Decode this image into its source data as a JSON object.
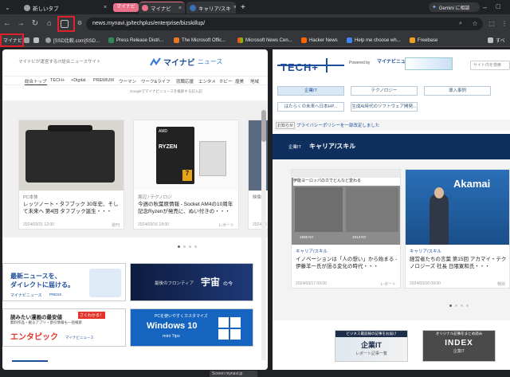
{
  "tabs": [
    {
      "label": "新しいタブ"
    },
    {
      "label": "マイナビ"
    },
    {
      "label": "キャリア/スキ"
    }
  ],
  "tab_group_label": "マイナビ",
  "gemini_label": "Gemini に相談",
  "url": "news.mynavi.jp/techplus/enterprise/bizskillup/",
  "bookmarks": {
    "label": "マイナビ",
    "items": [
      "[SSD比較.com]SSD...",
      "Press Release Distri...",
      "The Microsoft Offic...",
      "Microsoft News Cen...",
      "Hacker News",
      "Help me choose wh...",
      "Freebase"
    ],
    "all": "すべ"
  },
  "left": {
    "tagline": "マイナビが運営するIT総合ニュースサイト",
    "logo_main": "マイナビ",
    "logo_sub": "ニュース",
    "nav": [
      "総合トップ",
      "TECH+",
      "+Digital",
      "PREMIUM",
      "ウーマン",
      "ワーク&ライフ",
      "就職応援",
      "エンタメ",
      "ホビー",
      "煌美",
      "地域"
    ],
    "search_note": "Googleでマイナビニュースを検索する記入記",
    "cards": [
      {
        "cat": "PC本体",
        "title": "レッツノート・タフブック 30年史、そして未来へ 第4回 タフブック誕生・・・",
        "date": "2024/03/21 12:00"
      },
      {
        "cat": "周辺 / テクノロジ",
        "title": "今週の秋葉原情報 - Socket AM4の10周年記念Ryzenが発売に、ぬい付きの・・・",
        "date": "2024/03/16 18:00"
      },
      {
        "cat": "映像",
        "title": "",
        "date": "2024/03"
      }
    ],
    "card_badges": [
      "週刊",
      "レポート"
    ],
    "ryzen_brand": "AMD",
    "ryzen_word": "RYZEN",
    "ryzen_num": "7",
    "banners": {
      "b1_line1": "最新ニュースを、",
      "b1_line2": "ダイレクトに届ける。",
      "b1_brand": "マイナビニュース",
      "b1_sub": "PRESS",
      "b2_text": "最後のフロンティア",
      "b2_big": "宇宙",
      "b2_small": "の今",
      "b3_line1": "読みたい漫画の最安値",
      "b3_tag": "さくわかる！",
      "b3_line2": "無料作品・掘るアプリ・割引情報も一括検索",
      "b3_brand": "エンタピック",
      "b3_by": "マイナビニュース",
      "b4_line1": "PCを使いやすくカスタマイズ",
      "b4_big": "Windows 10",
      "b4_small": "mini Tips"
    }
  },
  "right": {
    "logo": "TECH+",
    "powered": "Powered by",
    "powered_brand": "マイナビニュース",
    "search_placeholder": "サイト内を検索",
    "menu": [
      "企業IT",
      "テクノロジー",
      "導入事例"
    ],
    "submenu": [
      "はたらくの未来へ日本HP...",
      "生成AI時代のソフトウェア開発..."
    ],
    "notice_tag": "お知らせ",
    "notice": "プライバシーポリシーを一部改定しました",
    "section_tag": "企業IT",
    "section_title": "キャリア/スキル",
    "cards": [
      {
        "cat": "キャリア/スキル",
        "title": "イノベーションは「人の想い」から始まる - 伊藤羊一氏が語る変化の時代・・・",
        "date": "2024/03/17 09:00"
      },
      {
        "cat": "キャリア/スキル",
        "title": "経営者たちの言葉 第15回 アカマイ・テクノロジーズ 社長 日隈寛和氏・・・",
        "date": "2024/03/16 09:00"
      }
    ],
    "card_badges": [
      "レポート",
      "特別"
    ],
    "img1_caption": "伊能ヨーロッパのカでどんなど変わる",
    "img1_label1": "1908 NY",
    "img1_label2": "1913 NY",
    "akamai": "Akamai",
    "banner1_small": "ビジネス最前線の記事をお届け",
    "banner1_big": "企業IT",
    "banner1_sub": "レポート記事一覧",
    "banner2_small": "オリジナル記事をまとめ読み",
    "banner2_big": "INDEX",
    "banner2_sub": "企業IT"
  },
  "taskbar": {
    "item": "Screen mynavi.jp"
  }
}
